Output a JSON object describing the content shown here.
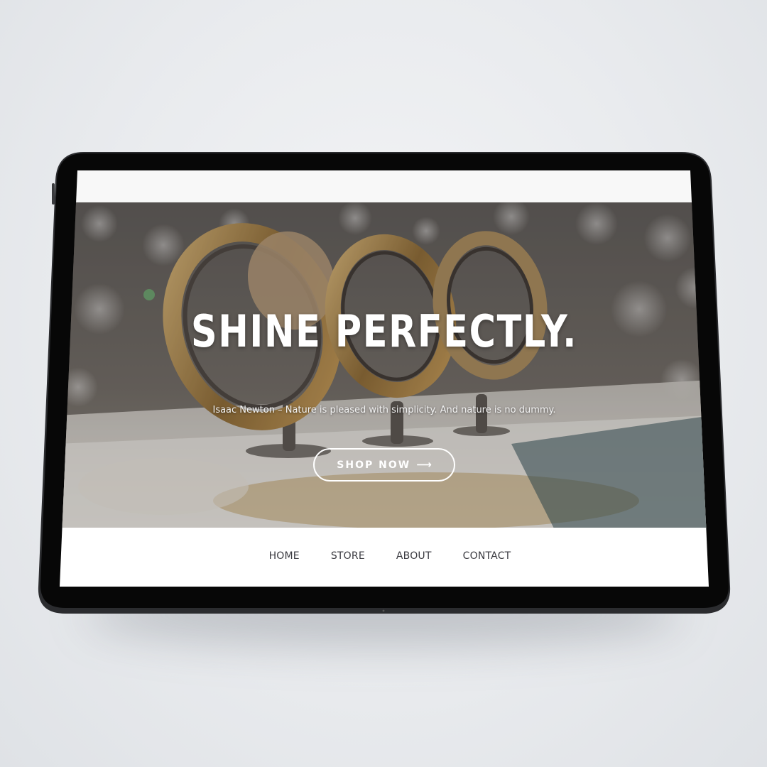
{
  "hero": {
    "title": "SHINE PERFECTLY.",
    "quote": "Isaac Newton – Nature is pleased with simplicity. And nature is no dummy.",
    "cta_label": "SHOP NOW",
    "cta_icon": "arrow-right-icon",
    "cta_arrow": "⟶",
    "image": "jewelry-display-photo"
  },
  "nav": {
    "items": [
      {
        "label": "HOME"
      },
      {
        "label": "STORE"
      },
      {
        "label": "ABOUT"
      },
      {
        "label": "CONTACT"
      }
    ]
  },
  "colors": {
    "background": "#e9ebee",
    "device_frame": "#0a0a0a",
    "device_edge": "#2c2d30",
    "screen_top": "#f8f8f8",
    "nav_bg": "#ffffff",
    "nav_text": "#3a3a40",
    "hero_text": "#ffffff"
  }
}
